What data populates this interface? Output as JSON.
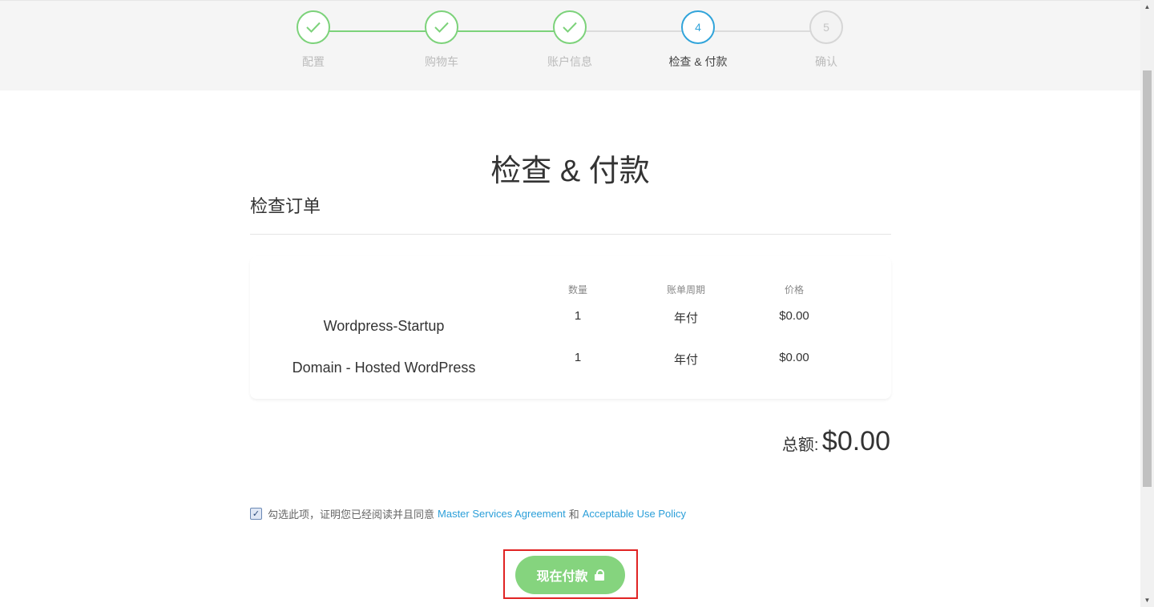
{
  "steps": [
    {
      "label": "配置",
      "number": "",
      "state": "done"
    },
    {
      "label": "购物车",
      "number": "",
      "state": "done"
    },
    {
      "label": "账户信息",
      "number": "",
      "state": "done"
    },
    {
      "label": "检查 & 付款",
      "number": "4",
      "state": "active"
    },
    {
      "label": "确认",
      "number": "5",
      "state": "pending"
    }
  ],
  "page": {
    "title": "检查 & 付款",
    "section_title": "检查订单"
  },
  "order": {
    "headers": {
      "qty": "数量",
      "cycle": "账单周期",
      "price": "价格"
    },
    "items": [
      {
        "name": "Wordpress-Startup",
        "qty": "1",
        "cycle": "年付",
        "price": "$0.00"
      },
      {
        "name": "Domain - Hosted WordPress",
        "qty": "1",
        "cycle": "年付",
        "price": "$0.00"
      }
    ]
  },
  "total": {
    "label": "总额:",
    "value": "$0.00"
  },
  "agreement": {
    "checked": true,
    "text": "勾选此项，证明您已经阅读并且同意",
    "link1": "Master Services Agreement",
    "and": "和",
    "link2": "Acceptable Use Policy"
  },
  "pay_button": {
    "label": "现在付款",
    "icon": "lock-icon"
  },
  "colors": {
    "done": "#7cd27a",
    "active": "#31a4da",
    "pay_button": "#85d47e",
    "link": "#2b9fd9",
    "highlight": "#e02323"
  }
}
